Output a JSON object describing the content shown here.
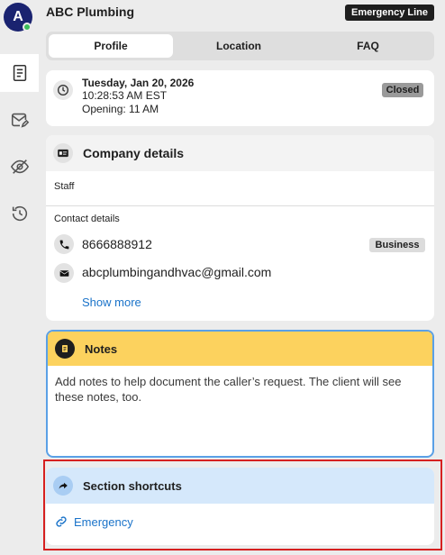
{
  "user": {
    "avatar_initial": "A",
    "online_color": "#3bbd5a"
  },
  "header": {
    "title": "ABC Plumbing",
    "emergency_button": "Emergency Line"
  },
  "tabs": [
    {
      "label": "Profile",
      "active": true
    },
    {
      "label": "Location",
      "active": false
    },
    {
      "label": "FAQ",
      "active": false
    }
  ],
  "sidebar": {
    "icons": [
      "notes-icon",
      "mail-edit-icon",
      "eye-slash-icon",
      "history-icon"
    ]
  },
  "status": {
    "date": "Tuesday, Jan 20, 2026",
    "time": "10:28:53 AM EST",
    "opening": "Opening: 11 AM",
    "badge": "Closed"
  },
  "company": {
    "title": "Company details",
    "staff_label": "Staff",
    "contact_label": "Contact details",
    "phone": "8666888912",
    "phone_badge": "Business",
    "email": "abcplumbingandhvac@gmail.com",
    "show_more": "Show more"
  },
  "notes": {
    "title": "Notes",
    "placeholder": "Add notes to help document the caller’s request. The client will see these notes, too."
  },
  "shortcuts": {
    "title": "Section shortcuts",
    "items": [
      {
        "label": "Emergency"
      }
    ]
  },
  "colors": {
    "accent_blue": "#1a73c9",
    "notes_yellow": "#fcd25e",
    "shortcuts_blue": "#d5e8fb",
    "highlight_red": "#d62020"
  }
}
